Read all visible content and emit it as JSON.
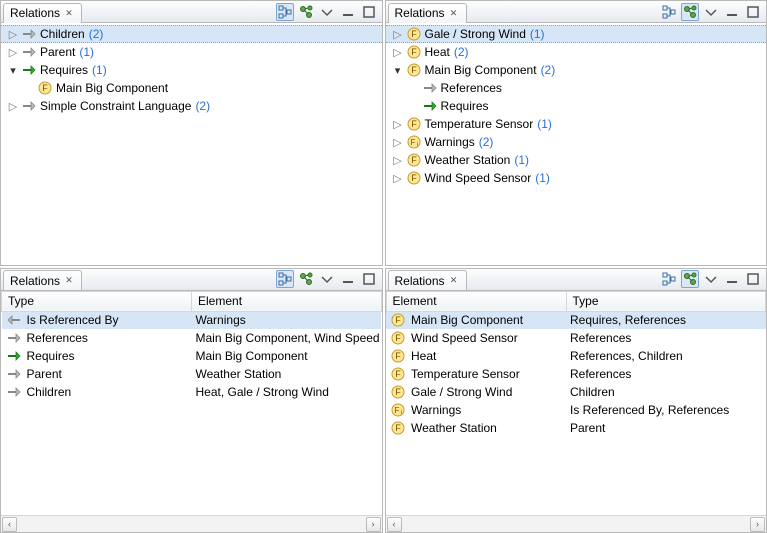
{
  "panes": {
    "topLeft": {
      "title": "Relations",
      "tree": [
        {
          "kind": "twisty-closed",
          "icon": "rel-gray",
          "label": "Children",
          "count": "(2)",
          "selected": true
        },
        {
          "kind": "twisty-closed",
          "icon": "rel-gray",
          "label": "Parent",
          "count": "(1)"
        },
        {
          "kind": "twisty-open",
          "icon": "rel-green",
          "label": "Requires",
          "count": "(1)"
        },
        {
          "kind": "child",
          "icon": "feat",
          "label": "Main Big Component"
        },
        {
          "kind": "twisty-closed",
          "icon": "rel-gray",
          "label": "Simple Constraint Language",
          "count": "(2)"
        }
      ]
    },
    "topRight": {
      "title": "Relations",
      "tree": [
        {
          "kind": "twisty-closed",
          "icon": "feat",
          "label": "Gale / Strong Wind",
          "count": "(1)",
          "selected": true
        },
        {
          "kind": "twisty-closed",
          "icon": "feat",
          "label": "Heat",
          "count": "(2)"
        },
        {
          "kind": "twisty-open",
          "icon": "feat",
          "label": "Main Big Component",
          "count": "(2)"
        },
        {
          "kind": "child",
          "icon": "rel-gray",
          "label": "References"
        },
        {
          "kind": "child",
          "icon": "rel-green",
          "label": "Requires"
        },
        {
          "kind": "twisty-closed",
          "icon": "feat",
          "label": "Temperature Sensor",
          "count": "(1)"
        },
        {
          "kind": "twisty-closed",
          "icon": "feat-i",
          "label": "Warnings",
          "count": "(2)"
        },
        {
          "kind": "twisty-closed",
          "icon": "feat",
          "label": "Weather Station",
          "count": "(1)"
        },
        {
          "kind": "twisty-closed",
          "icon": "feat",
          "label": "Wind Speed Sensor",
          "count": "(1)"
        }
      ]
    },
    "bottomLeft": {
      "title": "Relations",
      "columns": [
        "Type",
        "Element"
      ],
      "rows": [
        {
          "icon": "rel-gray-back",
          "c0": "Is Referenced By",
          "c1": "Warnings",
          "selected": true
        },
        {
          "icon": "rel-gray",
          "c0": "References",
          "c1": "Main Big Component, Wind Speed Se"
        },
        {
          "icon": "rel-green",
          "c0": "Requires",
          "c1": "Main Big Component"
        },
        {
          "icon": "rel-gray",
          "c0": "Parent",
          "c1": "Weather Station"
        },
        {
          "icon": "rel-gray",
          "c0": "Children",
          "c1": "Heat, Gale / Strong Wind"
        }
      ]
    },
    "bottomRight": {
      "title": "Relations",
      "columns": [
        "Element",
        "Type"
      ],
      "rows": [
        {
          "icon": "feat",
          "c0": "Main Big Component",
          "c1": "Requires, References",
          "selected": true
        },
        {
          "icon": "feat",
          "c0": "Wind Speed Sensor",
          "c1": "References"
        },
        {
          "icon": "feat",
          "c0": "Heat",
          "c1": "References, Children"
        },
        {
          "icon": "feat",
          "c0": "Temperature Sensor",
          "c1": "References"
        },
        {
          "icon": "feat",
          "c0": "Gale / Strong Wind",
          "c1": "Children"
        },
        {
          "icon": "feat-i",
          "c0": "Warnings",
          "c1": "Is Referenced By, References"
        },
        {
          "icon": "feat",
          "c0": "Weather Station",
          "c1": "Parent"
        }
      ]
    }
  }
}
